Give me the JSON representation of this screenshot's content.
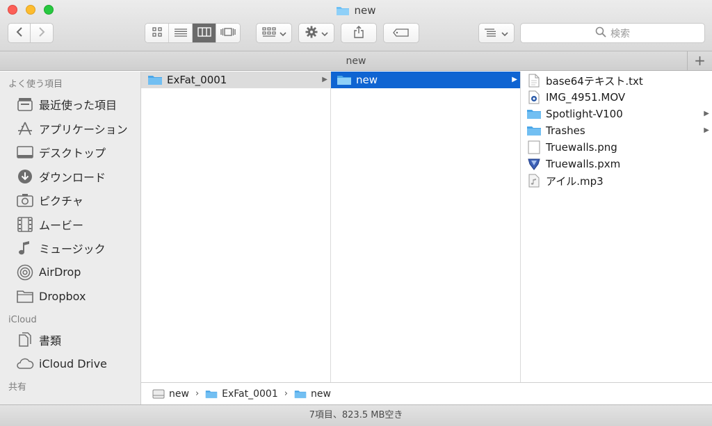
{
  "window": {
    "title": "new"
  },
  "toolbar": {
    "search_placeholder": "検索"
  },
  "tab": {
    "label": "new",
    "add_label": "+"
  },
  "sidebar": {
    "sections": [
      {
        "header": "よく使う項目",
        "items": [
          {
            "label": "最近使った項目",
            "icon": "recents-icon"
          },
          {
            "label": "アプリケーション",
            "icon": "applications-icon"
          },
          {
            "label": "デスクトップ",
            "icon": "desktop-icon"
          },
          {
            "label": "ダウンロード",
            "icon": "downloads-icon"
          },
          {
            "label": "ピクチャ",
            "icon": "camera-icon"
          },
          {
            "label": "ムービー",
            "icon": "film-icon"
          },
          {
            "label": "ミュージック",
            "icon": "music-note-icon"
          },
          {
            "label": "AirDrop",
            "icon": "airdrop-icon"
          },
          {
            "label": "Dropbox",
            "icon": "folder-icon"
          }
        ]
      },
      {
        "header": "iCloud",
        "items": [
          {
            "label": "書類",
            "icon": "documents-icon"
          },
          {
            "label": "iCloud Drive",
            "icon": "cloud-icon"
          }
        ]
      },
      {
        "header": "共有",
        "items": []
      }
    ]
  },
  "columns": {
    "col1": [
      {
        "label": "ExFat_0001",
        "icon": "folder-icon"
      }
    ],
    "col2": [
      {
        "label": "new",
        "icon": "folder-icon"
      }
    ],
    "col3": [
      {
        "label": "base64テキスト.txt",
        "icon": "text-file-icon"
      },
      {
        "label": "IMG_4951.MOV",
        "icon": "movie-file-icon"
      },
      {
        "label": "Spotlight-V100",
        "icon": "folder-icon"
      },
      {
        "label": "Trashes",
        "icon": "folder-icon"
      },
      {
        "label": "Truewalls.png",
        "icon": "image-file-icon"
      },
      {
        "label": "Truewalls.pxm",
        "icon": "pixelmator-file-icon"
      },
      {
        "label": "アイル.mp3",
        "icon": "audio-file-icon"
      }
    ]
  },
  "breadcrumb": [
    {
      "label": "new",
      "icon": "drive-icon"
    },
    {
      "label": "ExFat_0001",
      "icon": "folder-icon"
    },
    {
      "label": "new",
      "icon": "folder-icon"
    }
  ],
  "status": {
    "text": "7項目、823.5 MB空き"
  },
  "colors": {
    "selection_blue": "#0f64d2",
    "folder_blue": "#5bb3f0",
    "close": "#fc5f57",
    "minimize": "#fdbc2e",
    "zoom": "#27c840"
  }
}
